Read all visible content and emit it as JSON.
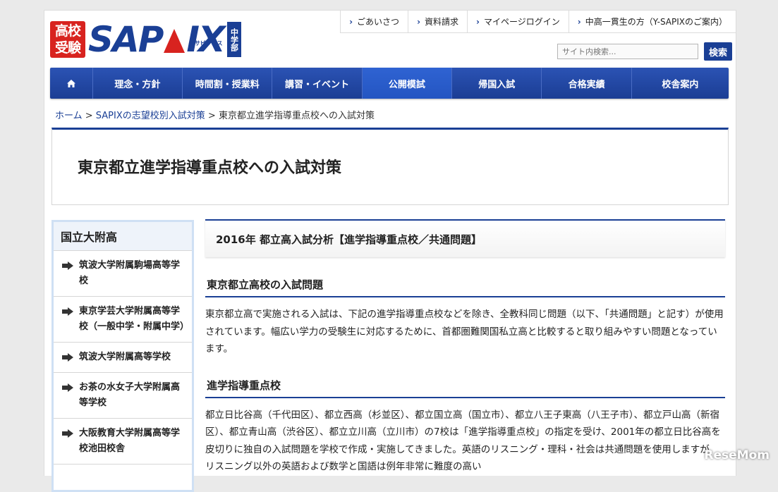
{
  "logo": {
    "badge_line1": "高校",
    "badge_line2": "受験",
    "word_left": "SAP",
    "word_right": "IX",
    "kana": "サピックス",
    "side": "中学部"
  },
  "utility_nav": [
    "ごあいさつ",
    "資料請求",
    "マイページログイン",
    "中高一貫生の方（Y-SAPIXのご案内）"
  ],
  "search": {
    "placeholder": "サイト内検索...",
    "button": "検索"
  },
  "main_nav": {
    "items": [
      {
        "label": "",
        "icon": "home-icon"
      },
      {
        "label": "理念・方針"
      },
      {
        "label": "時間割・授業料"
      },
      {
        "label": "講習・イベント"
      },
      {
        "label": "公開模試",
        "active": true
      },
      {
        "label": "帰国入試"
      },
      {
        "label": "合格実績"
      },
      {
        "label": "校舎案内"
      }
    ]
  },
  "breadcrumb": {
    "home": "ホーム",
    "sep": " > ",
    "level1": "SAPIXの志望校別入試対策",
    "current": "東京都立進学指導重点校への入試対策"
  },
  "page_title": "東京都立進学指導重点校への入試対策",
  "sidebar": {
    "heading": "国立大附高",
    "items": [
      "筑波大学附属駒場高等学校",
      "東京学芸大学附属高等学校（一般中学・附属中学）",
      "筑波大学附属高等学校",
      "お茶の水女子大学附属高等学校",
      "大阪教育大学附属高等学校池田校舎"
    ]
  },
  "article": {
    "heading": "2016年 都立高入試分析【進学指導重点校／共通問題】",
    "section1_title": "東京都立高校の入試問題",
    "section1_text": "東京都立高で実施される入試は、下記の進学指導重点校などを除き、全教科同じ問題（以下、「共通問題」と記す）が使用されています。幅広い学力の受験生に対応するために、首都圏難関国私立高と比較すると取り組みやすい問題となっています。",
    "section2_title": "進学指導重点校",
    "section2_text": "都立日比谷高（千代田区）、都立西高（杉並区）、都立国立高（国立市）、都立八王子東高（八王子市）、都立戸山高（新宿区）、都立青山高（渋谷区）、都立立川高（立川市）の7校は「進学指導重点校」の指定を受け、2001年の都立日比谷高を皮切りに独自の入試問題を学校で作成・実施してきました。英語のリスニング・理科・社会は共通問題を使用しますが、リスニング以外の英語および数学と国語は例年非常に難度の高い"
  },
  "watermark": "ReseMom"
}
